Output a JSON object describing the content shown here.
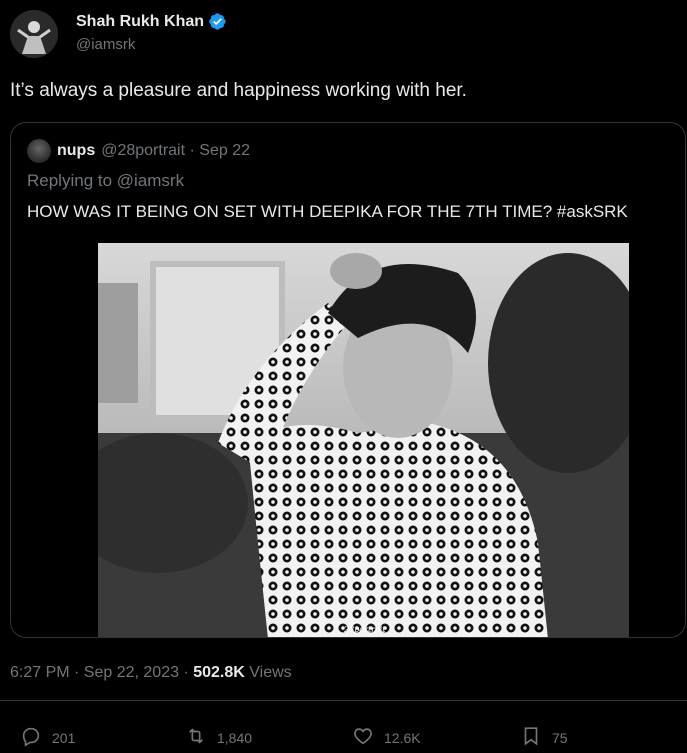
{
  "author": {
    "name": "Shah Rukh Khan",
    "handle": "@iamsrk"
  },
  "tweet": {
    "text": "It’s always a pleasure and happiness working with her."
  },
  "quote": {
    "name": "nups",
    "handle_date": "@28portrait · Sep 22",
    "replying_to": "Replying to @iamsrk",
    "text": "HOW WAS IT BEING ON SET WITH DEEPIKA FOR THE 7TH TIME? #askSRK",
    "watermark": "28portrait"
  },
  "meta": {
    "time": "6:27 PM · Sep 22, 2023 · ",
    "views_count": "502.8K",
    "views_label": " Views"
  },
  "actions": {
    "replies": "201",
    "reposts": "1,840",
    "likes": "12.6K",
    "bookmarks": "75"
  },
  "colors": {
    "background": "#000000",
    "text": "#e7e9ea",
    "secondary": "#71767b",
    "verified": "#1d9bf0",
    "border": "#2f3336"
  }
}
